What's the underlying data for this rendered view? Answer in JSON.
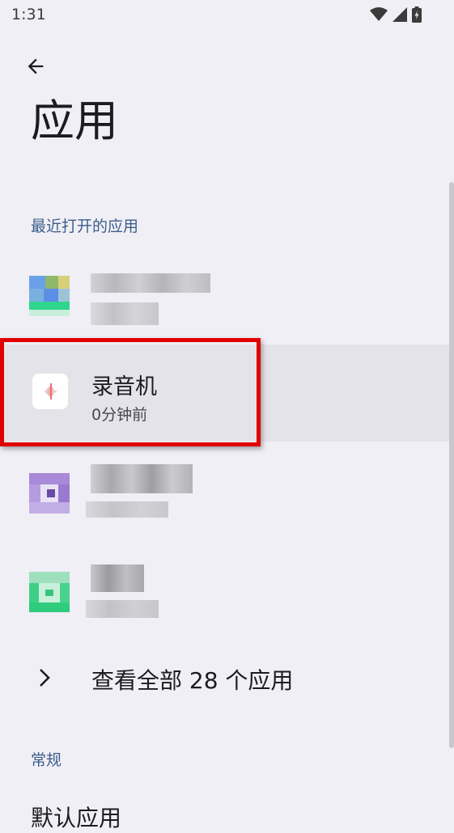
{
  "status_bar": {
    "time": "1:31"
  },
  "header": {
    "title": "应用"
  },
  "sections": {
    "recent": {
      "label": "最近打开的应用"
    },
    "general": {
      "label": "常规"
    }
  },
  "recent_apps": [
    {
      "name": "录音机",
      "last_opened": "0分钟前"
    }
  ],
  "see_all": {
    "label": "查看全部 28 个应用"
  },
  "next_item": {
    "label": "默认应用"
  },
  "colors": {
    "background": "#f0eff5",
    "accent": "#3b5d8a",
    "highlight": "#e4e3e9",
    "frame": "#e00000"
  }
}
